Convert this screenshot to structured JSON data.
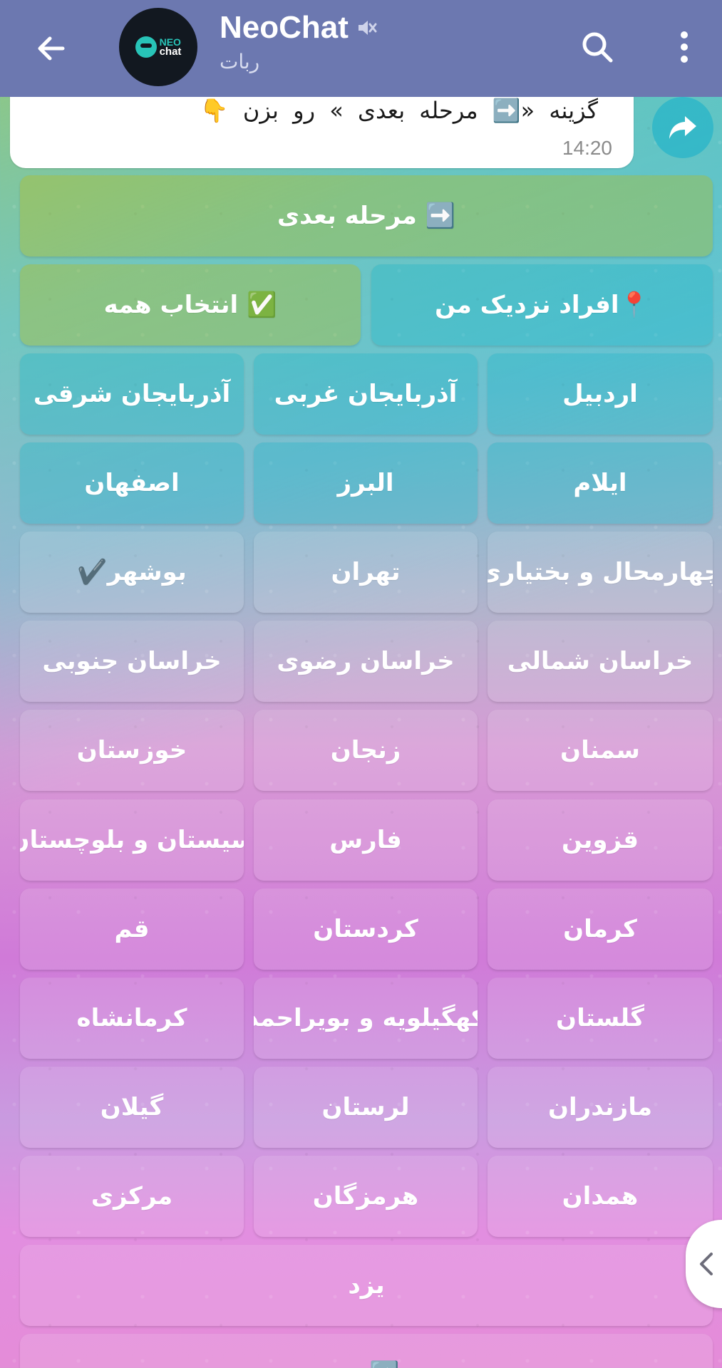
{
  "header": {
    "title": "NeoChat",
    "subtitle": "ربات",
    "avatar_text_top": "NEO",
    "avatar_text_bottom": "chat",
    "muted": true
  },
  "message": {
    "text": "گزینه «➡️ مرحله بعدی » رو بزن 👇",
    "time": "14:20"
  },
  "keyboard": {
    "next_step": "➡️ مرحله بعدی",
    "near_me": "📍افراد نزدیک من",
    "select_all": "✅ انتخاب همه",
    "provinces": [
      "اردبیل",
      "آذربایجان غربی",
      "آذربایجان شرقی",
      "ایلام",
      "البرز",
      "اصفهان",
      "چهارمحال و بختیاری",
      "تهران",
      "بوشهر✔️",
      "خراسان شمالی",
      "خراسان رضوی",
      "خراسان جنوبی",
      "سمنان",
      "زنجان",
      "خوزستان",
      "قزوین",
      "فارس",
      "سیستان و بلوچستان",
      "کرمان",
      "کردستان",
      "قم",
      "گلستان",
      "کهگیلویه و بویراحمد",
      "کرمانشاه",
      "مازندران",
      "لرستان",
      "گیلان",
      "همدان",
      "هرمزگان",
      "مرکزی"
    ],
    "last": "یزد",
    "bottom_partial": "➡️ ..."
  },
  "colors": {
    "header": "#6c78b0",
    "accent": "#28c4b8",
    "forward": "#28b4c8"
  }
}
